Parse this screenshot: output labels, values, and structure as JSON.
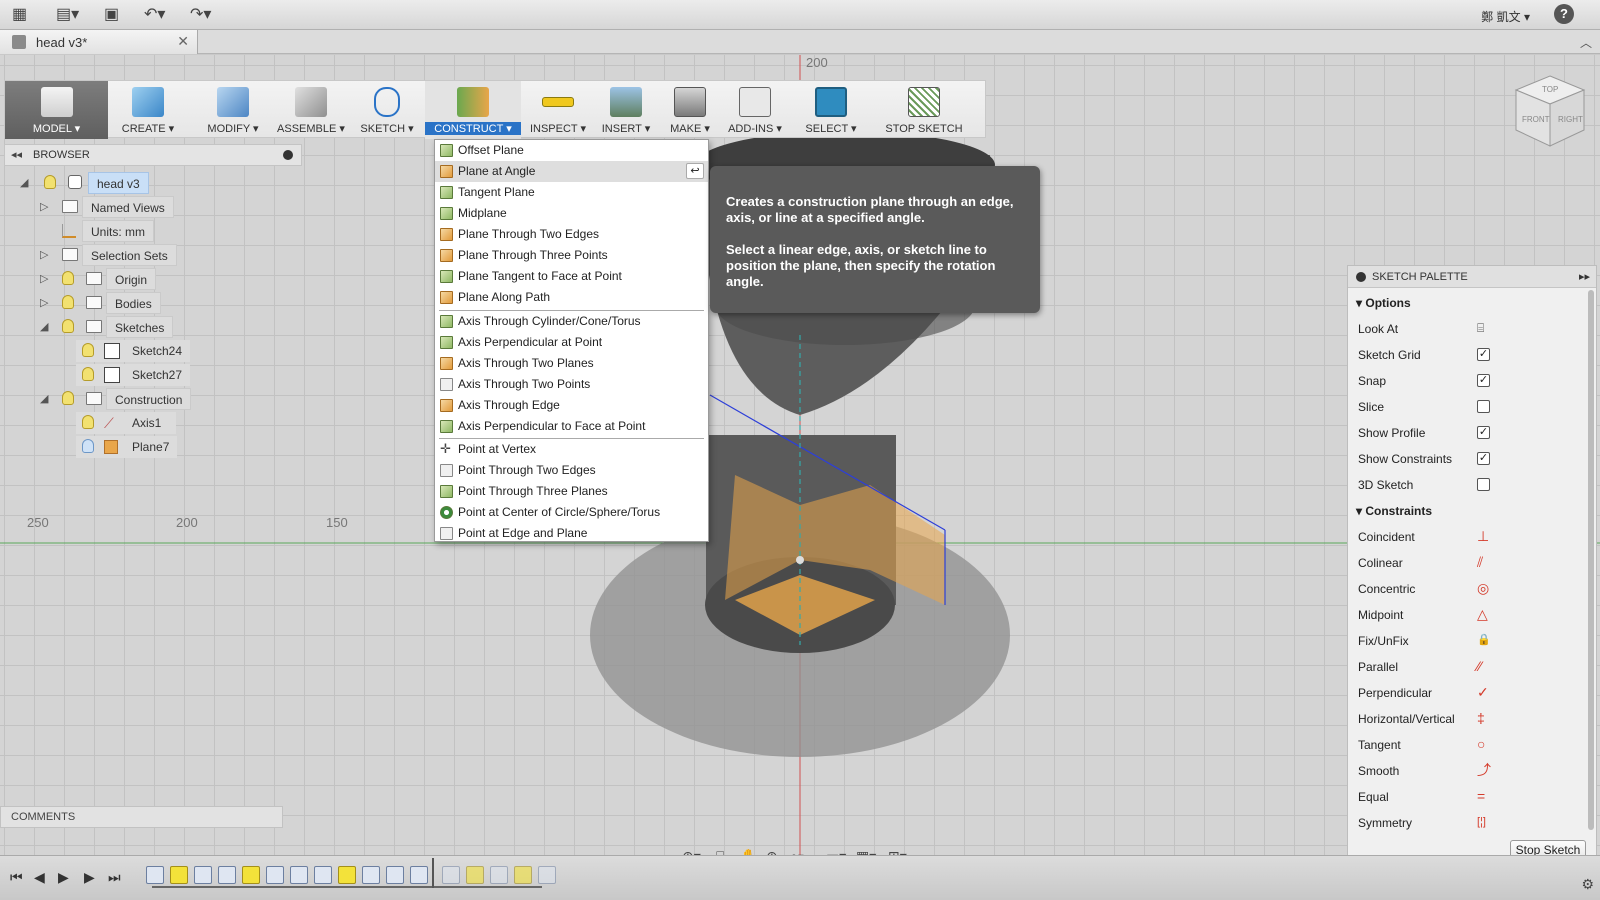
{
  "topbar": {
    "user_name": "鄭 凱文",
    "help": "?",
    "icons": [
      "grid-icon",
      "file-icon",
      "save-icon",
      "undo-icon",
      "redo-icon"
    ]
  },
  "tab": {
    "title": "head v3*",
    "close": "✕"
  },
  "toolbar": {
    "items": [
      {
        "label": "MODEL ▾",
        "icon": "model-icon"
      },
      {
        "label": "CREATE ▾",
        "icon": "create-icon"
      },
      {
        "label": "MODIFY ▾",
        "icon": "modify-icon"
      },
      {
        "label": "ASSEMBLE ▾",
        "icon": "assemble-icon"
      },
      {
        "label": "SKETCH ▾",
        "icon": "sketch-icon"
      },
      {
        "label": "CONSTRUCT ▾",
        "icon": "construct-icon"
      },
      {
        "label": "INSPECT ▾",
        "icon": "inspect-icon"
      },
      {
        "label": "INSERT ▾",
        "icon": "insert-icon"
      },
      {
        "label": "MAKE ▾",
        "icon": "make-icon"
      },
      {
        "label": "ADD-INS ▾",
        "icon": "addins-icon"
      },
      {
        "label": "SELECT ▾",
        "icon": "select-icon"
      },
      {
        "label": "STOP SKETCH",
        "icon": "stop-sketch-icon"
      }
    ]
  },
  "browser": {
    "title": "BROWSER",
    "root": "head v3",
    "nodes": {
      "named_views": "Named Views",
      "units": "Units: mm",
      "selection_sets": "Selection Sets",
      "origin": "Origin",
      "bodies": "Bodies",
      "sketches": "Sketches",
      "sketch24": "Sketch24",
      "sketch27": "Sketch27",
      "construction": "Construction",
      "axis1": "Axis1",
      "plane7": "Plane7"
    }
  },
  "canvas": {
    "grid_labels": [
      "200",
      "250",
      "200",
      "150"
    ]
  },
  "construct_menu": {
    "groups": [
      [
        "Offset Plane",
        "Plane at Angle",
        "Tangent Plane",
        "Midplane",
        "Plane Through Two Edges",
        "Plane Through Three Points",
        "Plane Tangent to Face at Point",
        "Plane Along Path"
      ],
      [
        "Axis Through Cylinder/Cone/Torus",
        "Axis Perpendicular at Point",
        "Axis Through Two Planes",
        "Axis Through Two Points",
        "Axis Through Edge",
        "Axis Perpendicular to Face at Point"
      ],
      [
        "Point at Vertex",
        "Point Through Two Edges",
        "Point Through Three Planes",
        "Point at Center of Circle/Sphere/Torus",
        "Point at Edge and Plane"
      ]
    ],
    "highlighted": "Plane at Angle"
  },
  "tooltip": {
    "line1": "Creates a construction plane through an edge, axis, or line at a specified angle.",
    "line2": "Select a linear edge, axis, or sketch line to position the plane, then specify the rotation angle."
  },
  "sketch_palette": {
    "title": "SKETCH PALETTE",
    "options_title": "Options",
    "options": [
      {
        "label": "Look At",
        "type": "icon",
        "value": "look-at-icon"
      },
      {
        "label": "Sketch Grid",
        "type": "check",
        "checked": true
      },
      {
        "label": "Snap",
        "type": "check",
        "checked": true
      },
      {
        "label": "Slice",
        "type": "check",
        "checked": false
      },
      {
        "label": "Show Profile",
        "type": "check",
        "checked": true
      },
      {
        "label": "Show Constraints",
        "type": "check",
        "checked": true
      },
      {
        "label": "3D Sketch",
        "type": "check",
        "checked": false
      }
    ],
    "constraints_title": "Constraints",
    "constraints": [
      {
        "label": "Coincident",
        "icon": "coincident-icon",
        "glyph": "⊥"
      },
      {
        "label": "Colinear",
        "icon": "colinear-icon",
        "glyph": "⫽"
      },
      {
        "label": "Concentric",
        "icon": "concentric-icon",
        "glyph": "◎"
      },
      {
        "label": "Midpoint",
        "icon": "midpoint-icon",
        "glyph": "△"
      },
      {
        "label": "Fix/UnFix",
        "icon": "lock-icon",
        "glyph": "🔒"
      },
      {
        "label": "Parallel",
        "icon": "parallel-icon",
        "glyph": "⁄⁄"
      },
      {
        "label": "Perpendicular",
        "icon": "perpendicular-icon",
        "glyph": "✓"
      },
      {
        "label": "Horizontal/Vertical",
        "icon": "horizontal-vertical-icon",
        "glyph": "‡"
      },
      {
        "label": "Tangent",
        "icon": "tangent-icon",
        "glyph": "○"
      },
      {
        "label": "Smooth",
        "icon": "smooth-icon",
        "glyph": "⤴"
      },
      {
        "label": "Equal",
        "icon": "equal-icon",
        "glyph": "="
      },
      {
        "label": "Symmetry",
        "icon": "symmetry-icon",
        "glyph": "[¦]"
      }
    ],
    "stop_button": "Stop Sketch"
  },
  "comments": {
    "label": "COMMENTS"
  },
  "colors": {
    "accent": "#2a73c7",
    "constraint": "#d43a2a",
    "plane": "#e9a64a"
  }
}
